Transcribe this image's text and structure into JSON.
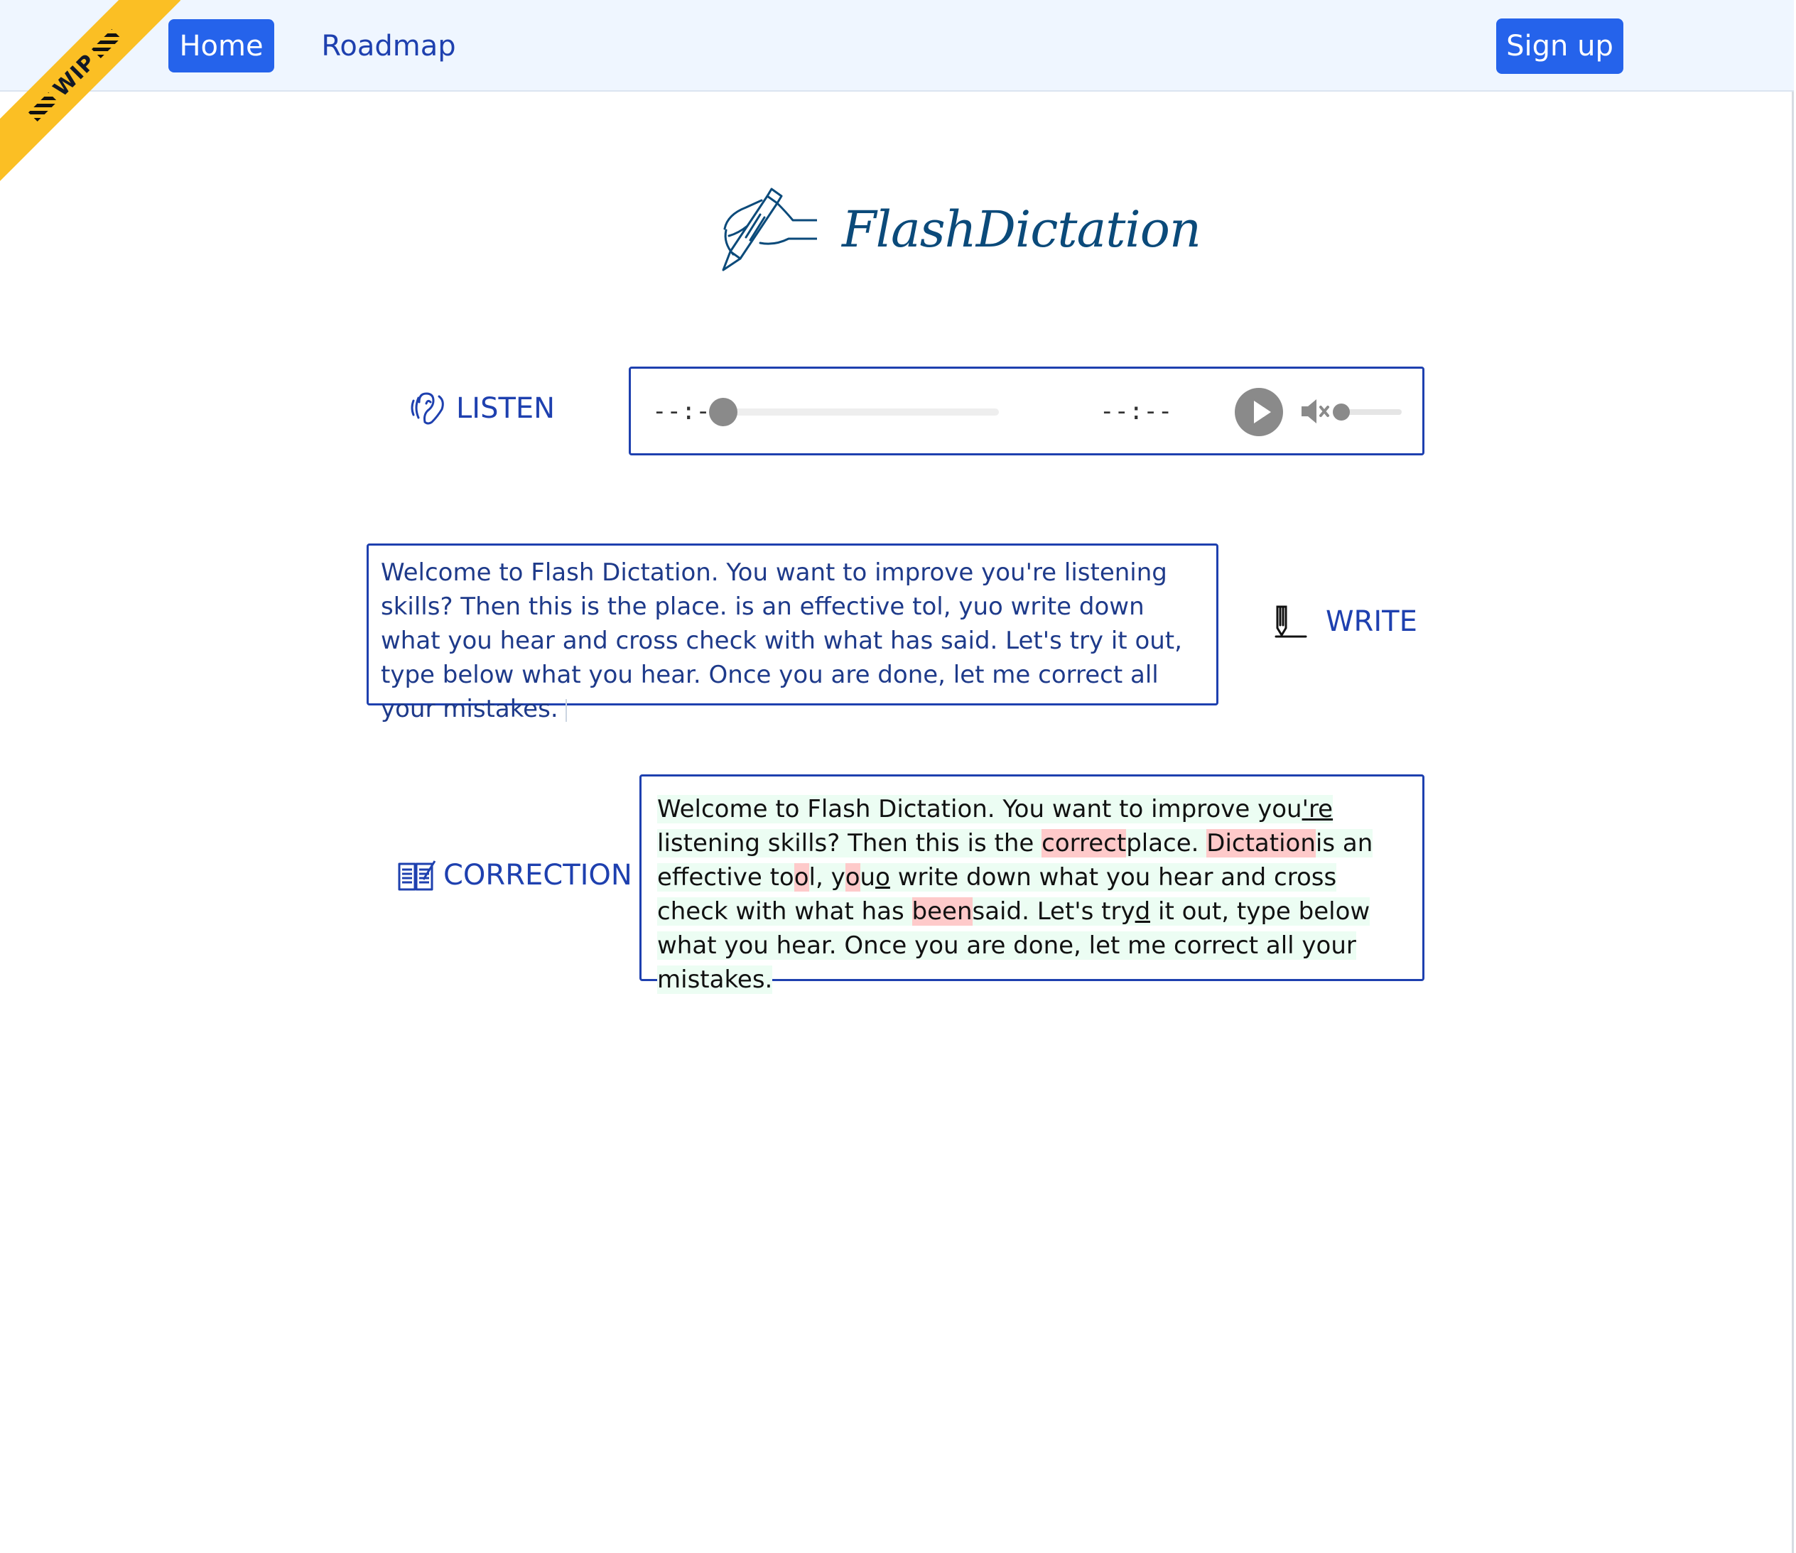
{
  "nav": {
    "home": "Home",
    "roadmap": "Roadmap",
    "signup": "Sign up",
    "wip": "WIP"
  },
  "logo": {
    "text": "FlashDictation"
  },
  "listen": {
    "label": "LISTEN",
    "current_time": "--:--",
    "duration": "--:--"
  },
  "write": {
    "label": "WRITE",
    "value": "Welcome to Flash Dictation. You want to improve you're listening skills? Then this is the place. is an effective tol, yuo write down what you hear and cross check with what has said. Let's try it out, type below what you hear. Once you are done, let me correct all your mistakes."
  },
  "correction": {
    "label": "CORRECTION",
    "segments": [
      {
        "t": "Welcome to Flash Dictation. You want to improve you",
        "k": "ok"
      },
      {
        "t": "'",
        "k": "ins"
      },
      {
        "t": "re",
        "k": "ins"
      },
      {
        "t": " listening skills? Then this is the ",
        "k": "ok"
      },
      {
        "t": "correct",
        "k": "bad"
      },
      {
        "t": "place. ",
        "k": "ok"
      },
      {
        "t": "Dictation",
        "k": "bad"
      },
      {
        "t": "is an effective to",
        "k": "ok"
      },
      {
        "t": "o",
        "k": "bad"
      },
      {
        "t": "l, y",
        "k": "ok"
      },
      {
        "t": "o",
        "k": "bad"
      },
      {
        "t": "u",
        "k": "ok"
      },
      {
        "t": "o",
        "k": "ins"
      },
      {
        "t": " write down what you hear and cross check with what has ",
        "k": "ok"
      },
      {
        "t": "been",
        "k": "bad"
      },
      {
        "t": "said. Let's try",
        "k": "ok"
      },
      {
        "t": "d",
        "k": "ins"
      },
      {
        "t": " it out, type below what you hear. Once you are done, let me correct all your mistakes.",
        "k": "ok"
      }
    ]
  }
}
